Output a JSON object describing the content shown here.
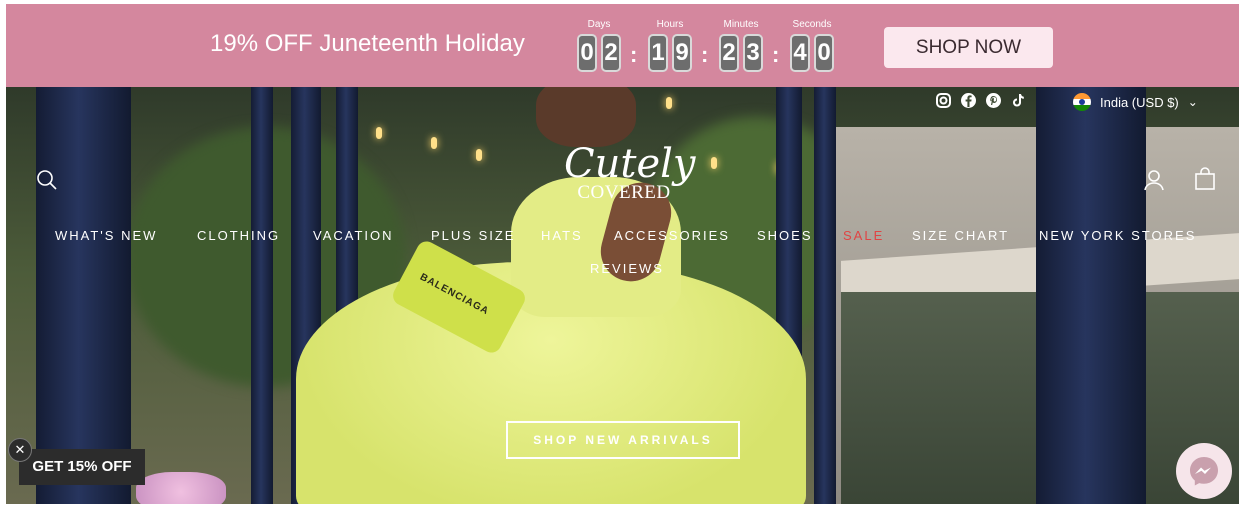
{
  "promo_bar": {
    "text": "19% OFF Juneteenth Holiday",
    "countdown": {
      "labels": {
        "days": "Days",
        "hours": "Hours",
        "minutes": "Minutes",
        "seconds": "Seconds"
      },
      "days": [
        "0",
        "2"
      ],
      "hours": [
        "1",
        "9"
      ],
      "minutes": [
        "2",
        "3"
      ],
      "seconds": [
        "4",
        "0"
      ],
      "separator": ":"
    },
    "cta_label": "SHOP NOW",
    "background_color": "#d4879e"
  },
  "header": {
    "social_icons": [
      "instagram-icon",
      "facebook-icon",
      "pinterest-icon",
      "tiktok-icon"
    ],
    "country_selector": "India (USD $)",
    "logo": {
      "script": "Cutely",
      "sub": "COVERED"
    },
    "nav": [
      {
        "label": "WHAT'S NEW"
      },
      {
        "label": "CLOTHING"
      },
      {
        "label": "VACATION"
      },
      {
        "label": "PLUS SIZE"
      },
      {
        "label": "HATS"
      },
      {
        "label": "ACCESSORIES"
      },
      {
        "label": "SHOES"
      },
      {
        "label": "SALE",
        "color": "#e04444"
      },
      {
        "label": "SIZE CHART"
      },
      {
        "label": "NEW YORK STORES"
      },
      {
        "label": "REVIEWS"
      }
    ]
  },
  "hero": {
    "cta_label": "SHOP NEW ARRIVALS",
    "bag_text": "BALENCIAGA"
  },
  "widgets": {
    "discount_label": "GET 15% OFF",
    "discount_close": "✕"
  }
}
